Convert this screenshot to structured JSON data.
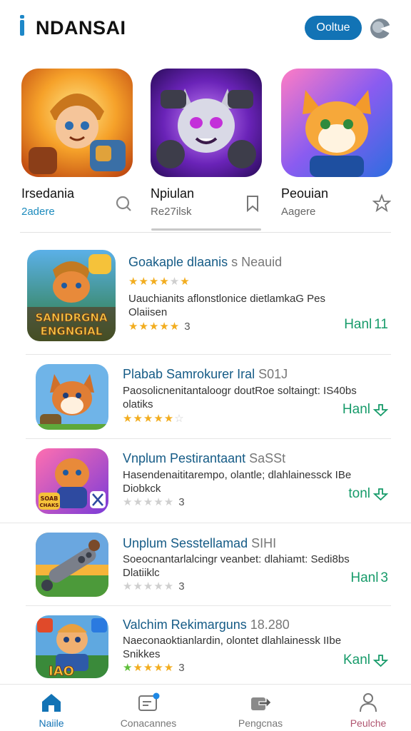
{
  "header": {
    "brand": "NDANSAI",
    "online_button": "Ooltue"
  },
  "featured": [
    {
      "title": "Irsedania",
      "subtitle": "2adere"
    },
    {
      "title": "Npiulan",
      "subtitle": "Re27ilsk"
    },
    {
      "title": "Peouian",
      "subtitle": "Aagere"
    }
  ],
  "list": [
    {
      "title": "Goakaple dlaanis",
      "title_extra": "s Neauid",
      "desc": "Uauchianits aflonstlonice dietlamkaG Pes Olaiisen",
      "rating_text": "3",
      "action": "Hanl",
      "action_suffix": "11",
      "art_text": "SANIDRGNA ENGNGIAL"
    },
    {
      "title": "Plabab Samrokurer Iral",
      "title_extra": "S01J",
      "desc": "Paosolicnenitantaloogr doutRoe soltaingt: IS40bs olatiks",
      "rating_text": "",
      "action": "Hanl",
      "action_suffix": "",
      "art_text": ""
    },
    {
      "title": "Vnplum Pestirantaant",
      "title_extra": "SaSSt",
      "desc": "Hasendenaititarempo, olantle; dlahlainessck IBe Diobkck",
      "rating_text": "3",
      "action": "tonl",
      "action_suffix": "",
      "art_text": "SOAB CHAKS"
    },
    {
      "title": "Unplum Sesstellamad",
      "title_extra": "SIHI",
      "desc": "Soeocnantarlalcingr veanbet: dlahiamt: Sedi8bs Dlatiiklc",
      "rating_text": "3",
      "action": "Hanl",
      "action_suffix": "3",
      "art_text": ""
    },
    {
      "title": "Valchim Rekimarguns",
      "title_extra": "18.280",
      "desc": "Naeconaoktianlardin, olontet dlahlainessk IIbe Snikkes",
      "rating_text": "3",
      "action": "Kanl",
      "action_suffix": "",
      "art_text": "IAO"
    }
  ],
  "nav": [
    {
      "label": "Naiile",
      "icon": "home-icon"
    },
    {
      "label": "Conacannes",
      "icon": "card-icon"
    },
    {
      "label": "Pengcnas",
      "icon": "share-icon"
    },
    {
      "label": "Peulche",
      "icon": "person-icon"
    }
  ],
  "colors": {
    "primary": "#1273b5",
    "title_blue": "#155b86",
    "action_green": "#179b6a",
    "star": "#f2ad1f"
  }
}
